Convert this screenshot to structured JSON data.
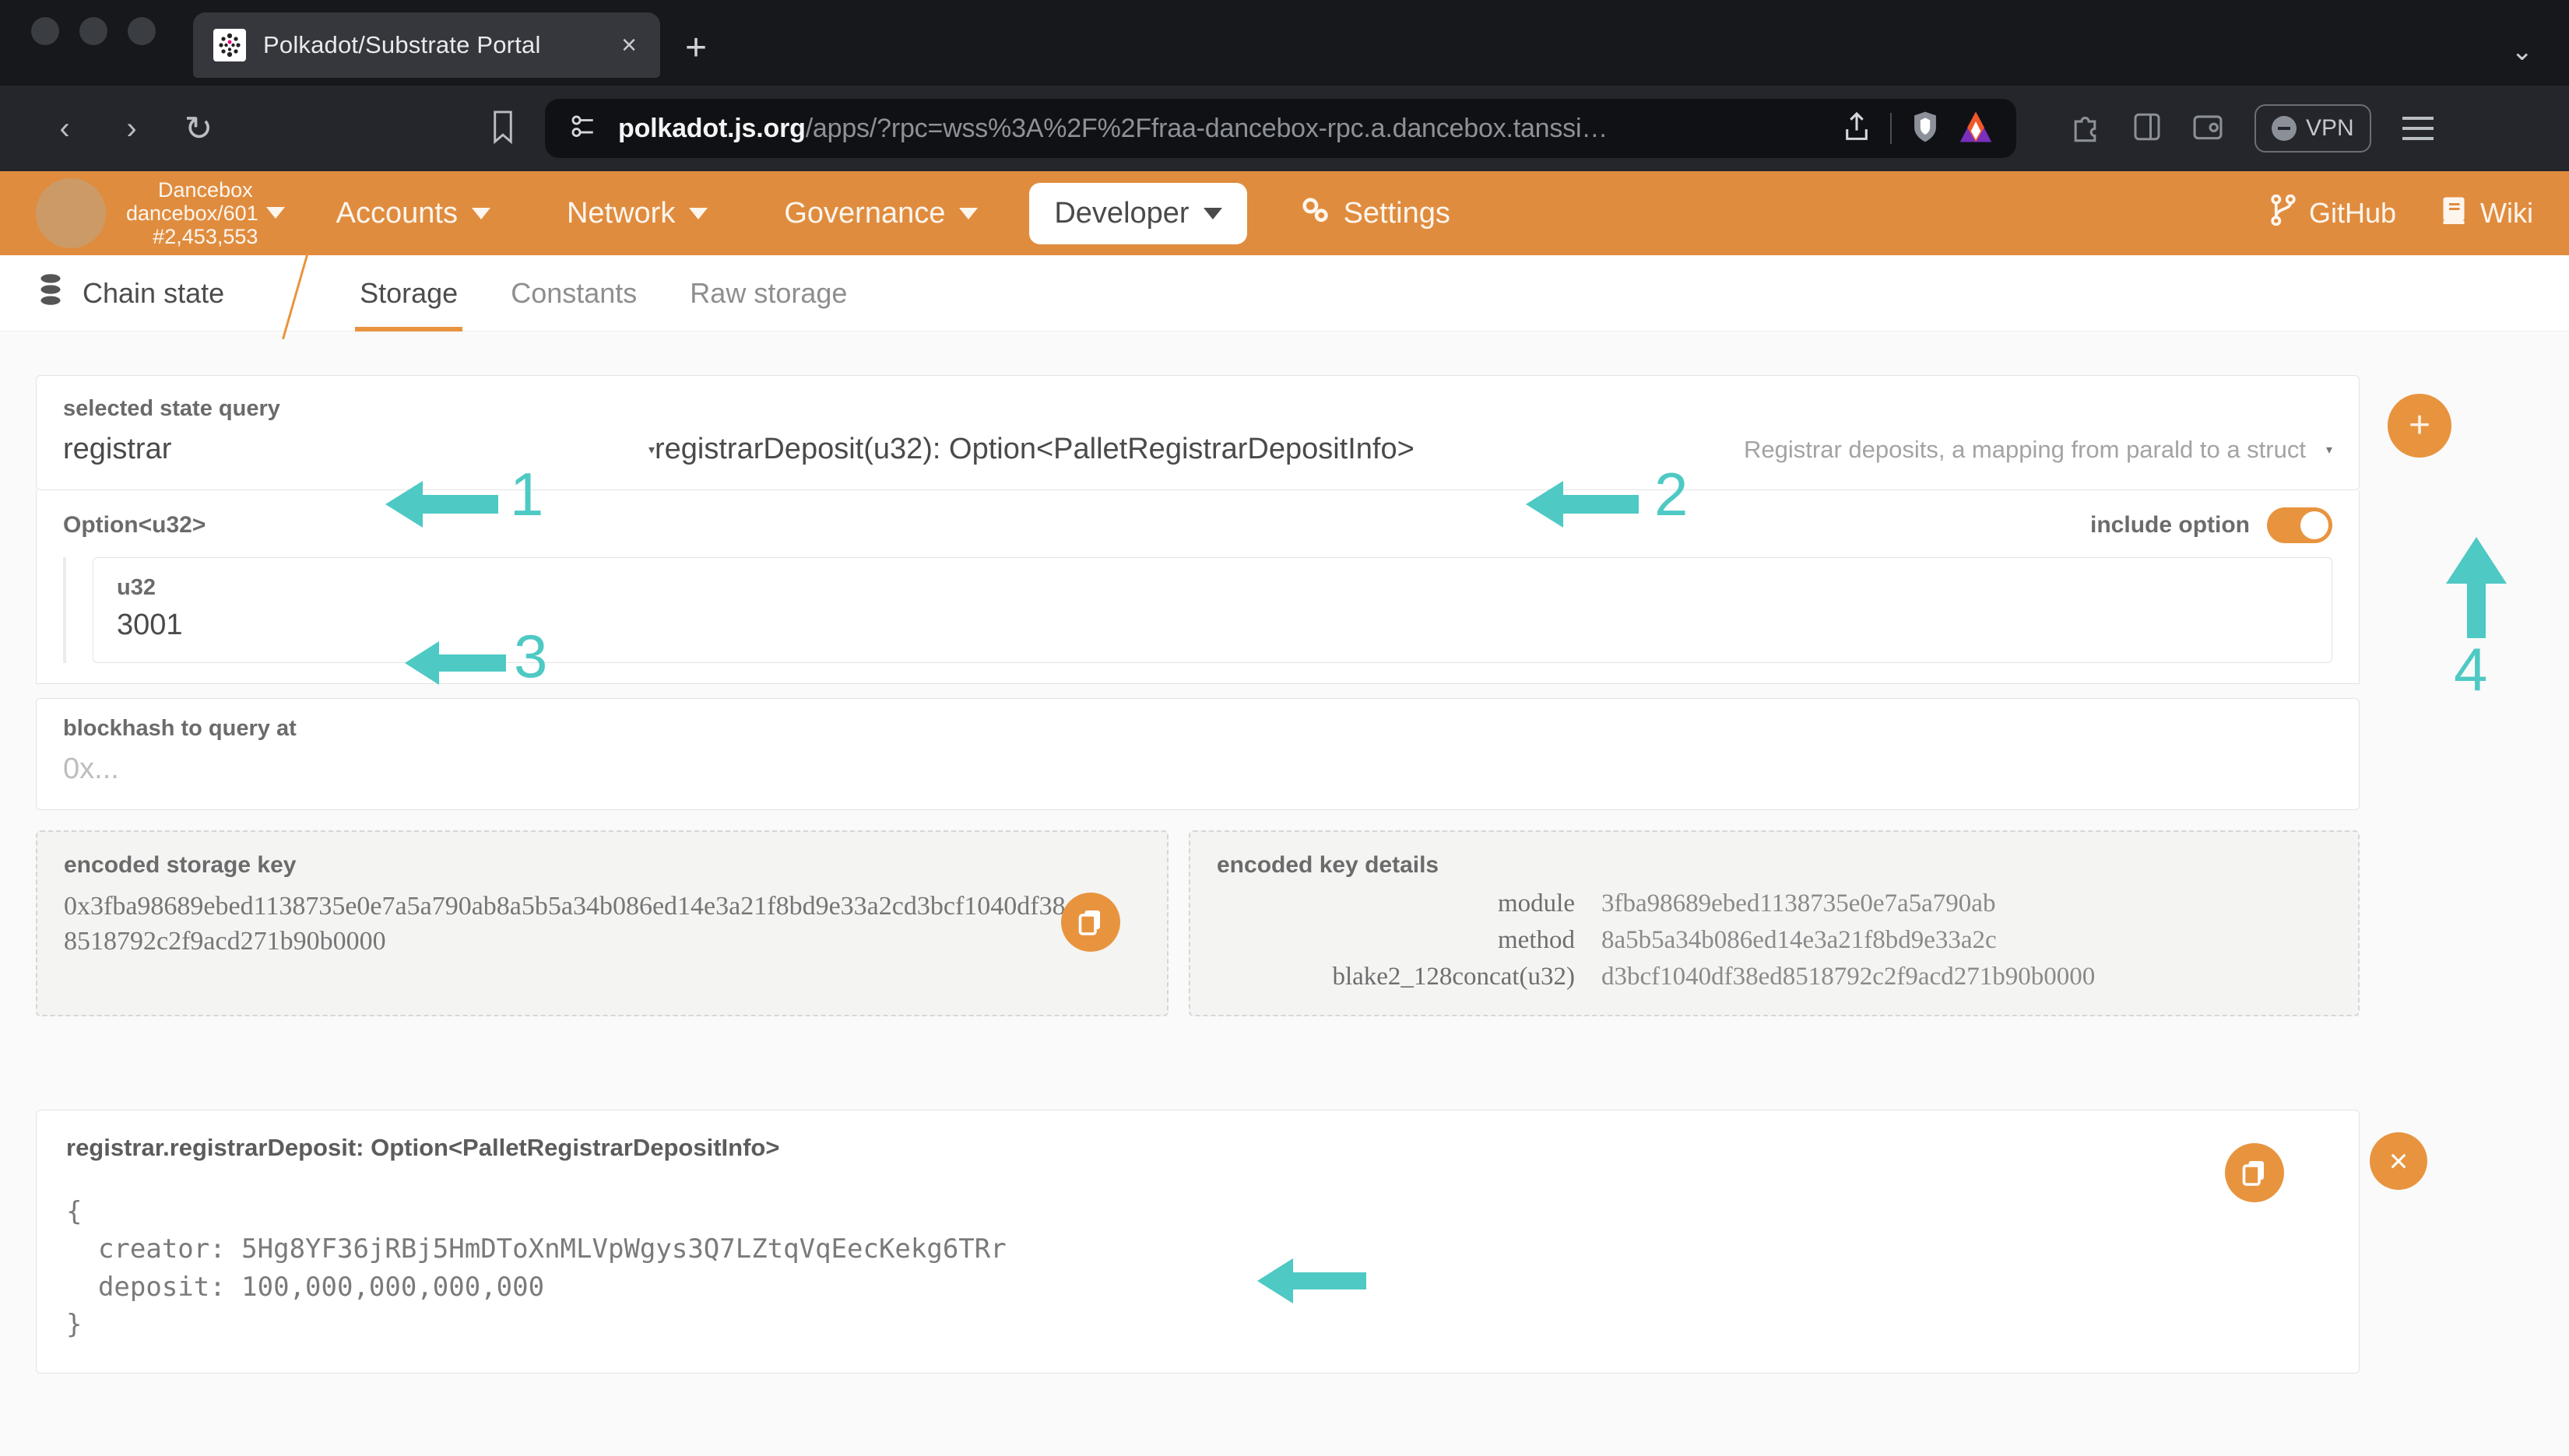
{
  "browser": {
    "tab_title": "Polkadot/Substrate Portal",
    "tab_close": "×",
    "new_tab": "+",
    "window_chevron": "⌄",
    "back_icon": "‹",
    "forward_icon": "›",
    "reload_icon": "↻",
    "url_domain": "polkadot.js.org",
    "url_path": "/apps/?rpc=wss%3A%2F%2Ffraa-dancebox-rpc.a.dancebox.tanssi…",
    "vpn_label": "VPN"
  },
  "appbar": {
    "chain_name": "Dancebox",
    "chain_spec": "dancebox/601",
    "chain_block": "#2,453,553",
    "menu": [
      {
        "label": "Accounts",
        "active": false
      },
      {
        "label": "Network",
        "active": false
      },
      {
        "label": "Governance",
        "active": false
      },
      {
        "label": "Developer",
        "active": true
      },
      {
        "label": "Settings",
        "active": false
      }
    ],
    "github_label": "GitHub",
    "wiki_label": "Wiki"
  },
  "tabbar": {
    "section": "Chain state",
    "tabs": [
      {
        "label": "Storage",
        "active": true
      },
      {
        "label": "Constants",
        "active": false
      },
      {
        "label": "Raw storage",
        "active": false
      }
    ]
  },
  "query": {
    "label": "selected state query",
    "pallet": "registrar",
    "method": "registrarDeposit(u32): Option<PalletRegistrarDepositInfo>",
    "description": "Registrar deposits, a mapping from parald to a struct",
    "caret": "▾"
  },
  "option_section": {
    "title": "Option<u32>",
    "include_option_label": "include option",
    "include_option_on": true,
    "arg_type": "u32",
    "arg_value": "3001"
  },
  "blockhash": {
    "label": "blockhash to query at",
    "placeholder": "0x..."
  },
  "encoded_storage_key": {
    "label": "encoded storage key",
    "value_line1": "0x3fba98689ebed1138735e0e7a5a790ab8a5b5a34b086ed14e3a21f8bd9",
    "value_line2": "e33a2cd3bcf1040df38ed8518792c2f9acd271b90b0000"
  },
  "encoded_key_details": {
    "label": "encoded key details",
    "rows": [
      {
        "key": "module",
        "value": "3fba98689ebed1138735e0e7a5a790ab"
      },
      {
        "key": "method",
        "value": "8a5b5a34b086ed14e3a21f8bd9e33a2c"
      },
      {
        "key": "blake2_128concat(u32)",
        "value": "d3bcf1040df38ed8518792c2f9acd271b90b0000"
      }
    ]
  },
  "result": {
    "title": "registrar.registrarDeposit: Option<PalletRegistrarDepositInfo>",
    "body": "{\n  creator: 5Hg8YF36jRBj5HmDToXnMLVpWgys3Q7LZtqVqEecKekg6TRr\n  deposit: 100,000,000,000,000\n}",
    "close_label": "×"
  },
  "rail": {
    "add_label": "+"
  },
  "annotations": {
    "color": "#4ec9c4",
    "markers": [
      {
        "id": "1",
        "label": "1"
      },
      {
        "id": "2",
        "label": "2"
      },
      {
        "id": "3",
        "label": "3"
      },
      {
        "id": "4",
        "label": "4"
      }
    ]
  },
  "colors": {
    "accent_orange": "#e8943f",
    "appbar_orange": "#e08c3e",
    "annotation_teal": "#4ec9c4",
    "page_bg": "#fafafa"
  }
}
